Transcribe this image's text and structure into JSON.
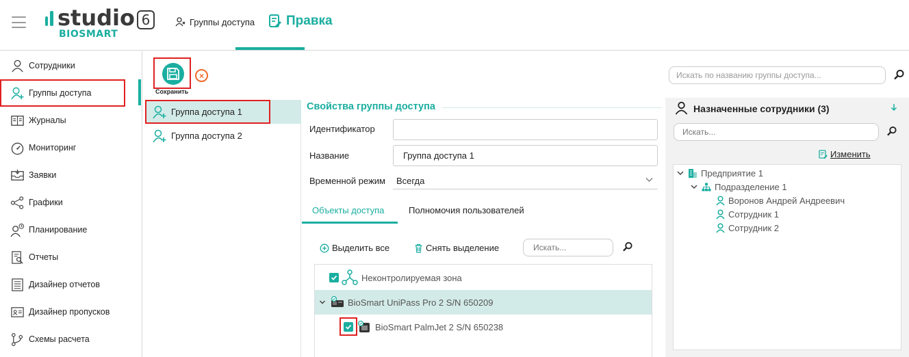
{
  "app": {
    "logo_word": "studio",
    "logo_version": "6",
    "logo_brand": "BIOSMART"
  },
  "breadcrumb": {
    "parent": "Группы доступа",
    "current": "Правка"
  },
  "sidebar": {
    "items": [
      {
        "label": "Сотрудники",
        "icon": "user-icon"
      },
      {
        "label": "Группы доступа",
        "icon": "user-group-add-icon"
      },
      {
        "label": "Журналы",
        "icon": "book-icon"
      },
      {
        "label": "Мониторинг",
        "icon": "gauge-icon"
      },
      {
        "label": "Заявки",
        "icon": "inbox-icon"
      },
      {
        "label": "Графики",
        "icon": "share-graph-icon"
      },
      {
        "label": "Планирование",
        "icon": "user-clock-icon"
      },
      {
        "label": "Отчеты",
        "icon": "report-search-icon"
      },
      {
        "label": "Дизайнер отчетов",
        "icon": "report-designer-icon"
      },
      {
        "label": "Дизайнер пропусков",
        "icon": "id-card-icon"
      },
      {
        "label": "Схемы расчета",
        "icon": "branch-icon"
      }
    ]
  },
  "toolbar": {
    "save_label": "Сохранить",
    "cancel_symbol": "×"
  },
  "group_search": {
    "placeholder": "Искать по названию группы доступа..."
  },
  "groups": [
    {
      "label": "Группа доступа 1",
      "selected": true
    },
    {
      "label": "Группа доступа 2",
      "selected": false
    }
  ],
  "properties": {
    "title": "Свойства группы доступа",
    "id_label": "Идентификатор",
    "id_value": "",
    "name_label": "Название",
    "name_value": "Группа доступа 1",
    "mode_label": "Временной режим",
    "mode_value": "Всегда"
  },
  "tabs": [
    {
      "label": "Объекты доступа",
      "active": true
    },
    {
      "label": "Полномочия пользователей",
      "active": false
    }
  ],
  "objects": {
    "select_all": "Выделить все",
    "deselect": "Снять выделение",
    "search_placeholder": "Искать...",
    "rows": [
      {
        "label": "Неконтролируемая зона",
        "checked": true
      },
      {
        "label": "BioSmart UniPass Pro 2 S/N 650209",
        "expanded": true
      },
      {
        "label": "BioSmart PalmJet 2 S/N 650238",
        "checked": true
      }
    ]
  },
  "assigned": {
    "title": "Назначенные сотрудники (3)",
    "search_placeholder": "Искать...",
    "change_label": "Изменить",
    "tree": [
      {
        "label": "Предприятие 1",
        "level": 0
      },
      {
        "label": "Подразделение 1",
        "level": 1
      },
      {
        "label": "Воронов Андрей Андреевич",
        "level": 2
      },
      {
        "label": "Сотрудник 1",
        "level": 2
      },
      {
        "label": "Сотрудник 2",
        "level": 2
      }
    ]
  },
  "colors": {
    "accent": "#1aaea0",
    "highlight_bg": "#d3ebe8",
    "annotation_red": "#e02020",
    "cancel_orange": "#f06a2c"
  }
}
